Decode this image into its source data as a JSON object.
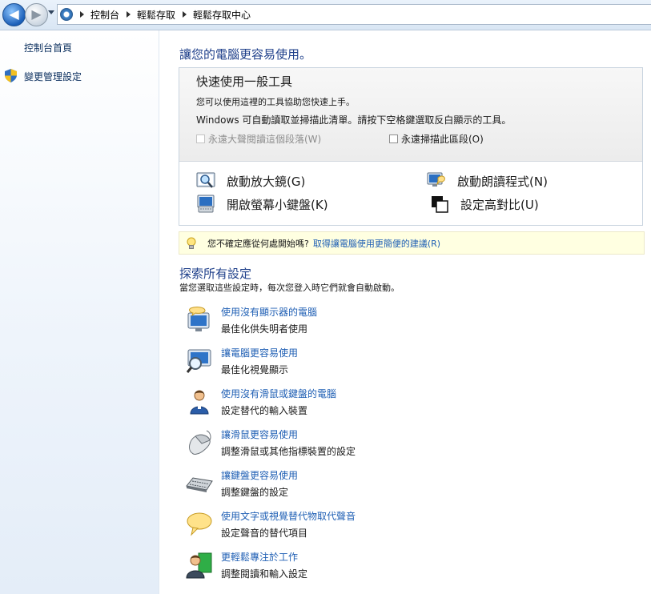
{
  "nav": {
    "back_glyph": "◀",
    "forward_glyph": "▶"
  },
  "breadcrumb": [
    "控制台",
    "輕鬆存取",
    "輕鬆存取中心"
  ],
  "leftnav": {
    "home": "控制台首頁",
    "admin": "變更管理設定"
  },
  "main": {
    "heading": "讓您的電腦更容易使用。",
    "quick": {
      "title": "快速使用一般工具",
      "line1": "您可以使用這裡的工具協助您快速上手。",
      "line2": "Windows 可自動讀取並掃描此清單。請按下空格鍵選取反白顯示的工具。",
      "chk_read": "永遠大聲閱讀這個段落(W)",
      "chk_scan": "永遠掃描此區段(O)",
      "tools": [
        {
          "label": "啟動放大鏡(G)",
          "icon": "magnifier-icon"
        },
        {
          "label": "啟動朗讀程式(N)",
          "icon": "narrator-icon"
        },
        {
          "label": "開啟螢幕小鍵盤(K)",
          "icon": "onscreen-keyboard-icon"
        },
        {
          "label": "設定高對比(U)",
          "icon": "high-contrast-icon"
        }
      ]
    },
    "tip": {
      "question": "您不確定應從何處開始嗎?",
      "link": "取得讓電腦使用更簡便的建議(R)"
    },
    "explore": {
      "title": "探索所有設定",
      "subtitle": "當您選取這些設定時，每次您登入時它們就會自動啟動。",
      "items": [
        {
          "title": "使用沒有顯示器的電腦",
          "desc": "最佳化供失明者使用",
          "icon": "monitor-speech-icon"
        },
        {
          "title": "讓電腦更容易使用",
          "desc": "最佳化視覺顯示",
          "icon": "monitor-magnify-icon"
        },
        {
          "title": "使用沒有滑鼠或鍵盤的電腦",
          "desc": "設定替代的輸入裝置",
          "icon": "person-icon"
        },
        {
          "title": "讓滑鼠更容易使用",
          "desc": "調整滑鼠或其他指標裝置的設定",
          "icon": "mouse-icon"
        },
        {
          "title": "讓鍵盤更容易使用",
          "desc": "調整鍵盤的設定",
          "icon": "keyboard-icon"
        },
        {
          "title": "使用文字或視覺替代物取代聲音",
          "desc": "設定聲音的替代項目",
          "icon": "speech-bubble-icon"
        },
        {
          "title": "更輕鬆專注於工作",
          "desc": "調整閱讀和輸入設定",
          "icon": "person-focus-icon"
        }
      ]
    }
  }
}
